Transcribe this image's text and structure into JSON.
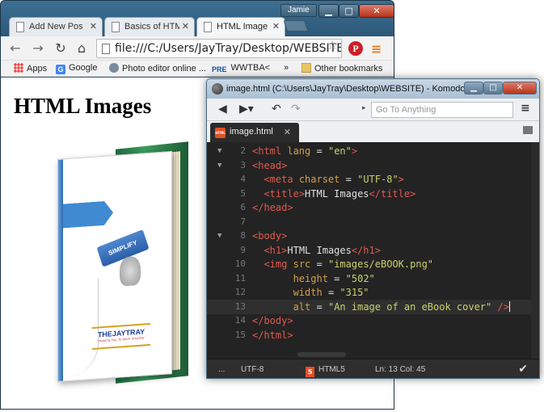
{
  "chrome": {
    "user": "Jamie",
    "tabs": [
      {
        "label": "Add New Pos",
        "active": false
      },
      {
        "label": "Basics of HTM",
        "active": false
      },
      {
        "label": "HTML Image",
        "active": true
      }
    ],
    "url": "file:///C:/Users/JayTray/Desktop/WEBSITE/",
    "bookmarks": {
      "apps": "Apps",
      "google": "Google",
      "photo": "Photo editor online ...",
      "wwtba": "WWTBA<",
      "more": "»",
      "other": "Other bookmarks"
    },
    "icons": {
      "google": "G",
      "wwtba": "PRE",
      "pinterest": "P"
    }
  },
  "page": {
    "heading": "HTML Images"
  },
  "ebook": {
    "key": "SIMPLIFY",
    "logo": "THEJAYTRAY",
    "logo_tag": "Helping You To Work Smarter"
  },
  "komodo": {
    "title": "image.html (C:\\Users\\JayTray\\Desktop\\WEBSITE) - Komodo E...",
    "goto_placeholder": "Go To Anything",
    "tab_label": "image.html",
    "tab_icon": "HTML",
    "lines": [
      {
        "num": "2",
        "fold": true,
        "code": "<html lang = \"en\">"
      },
      {
        "num": "3",
        "fold": true,
        "code": "<head>"
      },
      {
        "num": "4",
        "fold": false,
        "code": "  <meta charset = \"UTF-8\">"
      },
      {
        "num": "5",
        "fold": false,
        "code": "  <title>HTML Images</title>"
      },
      {
        "num": "6",
        "fold": false,
        "code": "</head>"
      },
      {
        "num": "7",
        "fold": false,
        "code": ""
      },
      {
        "num": "8",
        "fold": true,
        "code": "<body>"
      },
      {
        "num": "9",
        "fold": false,
        "code": "  <h1>HTML Images</h1>"
      },
      {
        "num": "10",
        "fold": false,
        "code": "  <img src = \"images/eBOOK.png\""
      },
      {
        "num": "11",
        "fold": false,
        "code": "       height = \"502\""
      },
      {
        "num": "12",
        "fold": false,
        "code": "       width = \"315\""
      },
      {
        "num": "13",
        "fold": false,
        "code": "       alt = \"An image of an eBook cover\" />"
      },
      {
        "num": "14",
        "fold": false,
        "code": "</body>"
      },
      {
        "num": "15",
        "fold": false,
        "code": "</html>"
      }
    ],
    "status": {
      "dots": "...",
      "encoding": "UTF-8",
      "html5_badge": "5",
      "language": "HTML5",
      "position": "Ln: 13 Col: 45"
    }
  }
}
